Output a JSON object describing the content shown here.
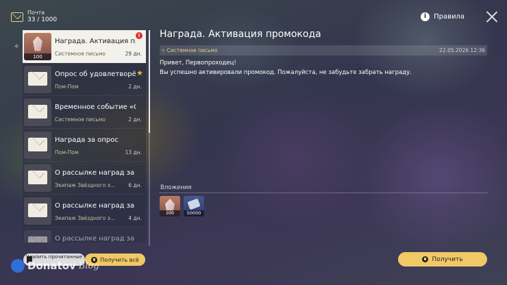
{
  "header": {
    "mail_label": "Почта",
    "mail_count": "33 / 1000",
    "rules_label": "Правила"
  },
  "mail_list": [
    {
      "title": "Награда. Активация пр...",
      "sender": "Системное письмо",
      "age": "29 дн.",
      "thumb": "crystal",
      "thumb_count": "100",
      "new": "!",
      "selected": true
    },
    {
      "title": "Опрос об удовлетворён...",
      "sender": "Пом-Пом",
      "age": "2 дн.",
      "thumb": "envelope",
      "starred": true
    },
    {
      "title": "Временное событие «С...",
      "sender": "Системное письмо",
      "age": "2 дн.",
      "thumb": "envelope"
    },
    {
      "title": "Награда за опрос",
      "sender": "Пом-Пом",
      "age": "13 дн.",
      "thumb": "envelope"
    },
    {
      "title": "О рассылке наград за с...",
      "sender": "Экипаж Звёздного э...",
      "age": "6 дн.",
      "thumb": "envelope"
    },
    {
      "title": "О рассылке наград за с...",
      "sender": "Экипаж Звёздного э...",
      "age": "4 дн.",
      "thumb": "envelope"
    },
    {
      "title": "О рассылке наград за с...",
      "sender": "",
      "age": "",
      "thumb": "envelope",
      "faded": true
    }
  ],
  "buttons": {
    "delete_read": "Удалить прочитанные",
    "claim_all": "Получить всё",
    "claim": "Получить"
  },
  "detail": {
    "title": "Награда. Активация промокода",
    "sender": "Системное письмо",
    "date": "22.05.2026 12:36",
    "greeting": "Привет, Первопроходец!",
    "body": "Вы успешно активировали промокод. Пожалуйста, не забудьте забрать награду.",
    "attachments_label": "Вложения",
    "attachments": [
      {
        "icon": "stellar-jade-icon",
        "qty": "100"
      },
      {
        "icon": "credit-ticket-icon",
        "qty": "50000"
      }
    ]
  },
  "watermark": {
    "name": "Donatov",
    "suffix": "Blog"
  },
  "colors": {
    "accent": "#f0c866",
    "sender": "#e2cf8d",
    "new_badge": "#d7322f",
    "star": "#f2b824"
  }
}
